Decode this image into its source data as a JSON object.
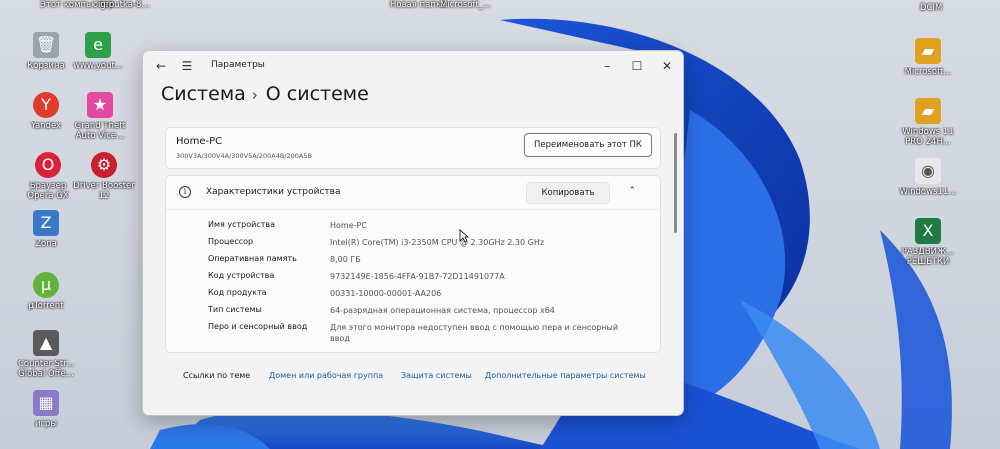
{
  "desktop": {
    "top_labels": {
      "this_pc": "Этот компьютер",
      "igroutka": "igroutka-8...",
      "new_folder": "Новая папка",
      "microsoft_top": "Microsoft_...",
      "dcim": "DCIM"
    },
    "left_icons": [
      {
        "label": "Корзина",
        "icon": "recycle-bin-icon",
        "color": "#9aa4b0"
      },
      {
        "label": "www.yout...",
        "icon": "web-shortcut-icon",
        "color": "#2fa04a"
      },
      {
        "label": "Yandex",
        "icon": "yandex-icon",
        "color": "#e03a2b"
      },
      {
        "label": "Grand Theft Auto Vice...",
        "icon": "gta-icon",
        "color": "#e44aa0"
      },
      {
        "label": "Браузер Opera GX",
        "icon": "opera-gx-icon",
        "color": "#d8243a"
      },
      {
        "label": "Driver Booster 12",
        "icon": "driver-booster-icon",
        "color": "#c81f2c"
      },
      {
        "label": "Zona",
        "icon": "zona-icon",
        "color": "#3a78c8"
      },
      {
        "label": "µTorrent",
        "icon": "utorrent-icon",
        "color": "#62b33c"
      },
      {
        "label": "Counter-Str... Global Offe...",
        "icon": "csgo-icon",
        "color": "#5a5a5a"
      },
      {
        "label": "игры",
        "icon": "games-folder-icon",
        "color": "#8a7ac8"
      }
    ],
    "right_icons": [
      {
        "label": "Microsoft...",
        "icon": "folder-icon",
        "color": "#e0a020"
      },
      {
        "label": "Windows 11 PRO 24H...",
        "icon": "folder-icon",
        "color": "#e0a020"
      },
      {
        "label": "Windows11...",
        "icon": "document-icon",
        "color": "#e8e8e8"
      },
      {
        "label": "РАЗДВИЖ... РЕШЕТКИ",
        "icon": "excel-icon",
        "color": "#1f7a45"
      }
    ]
  },
  "window": {
    "app_title": "Параметры",
    "breadcrumb_parent": "Система",
    "breadcrumb_separator": "›",
    "page_title": "О системе",
    "pc_name": "Home-PC",
    "pc_model": "300V3A/300V4A/300V5A/200A4B/200A5B",
    "rename_button": "Переименовать этот ПК",
    "specs_title": "Характеристики устройства",
    "copy_button": "Копировать",
    "specs": [
      {
        "label": "Имя устройства",
        "value": "Home-PC"
      },
      {
        "label": "Процессор",
        "value": "Intel(R) Core(TM) i3-2350M CPU @ 2.30GHz   2.30 GHz"
      },
      {
        "label": "Оперативная память",
        "value": "8,00 ГБ"
      },
      {
        "label": "Код устройства",
        "value": "9732149E-1856-4FFA-91B7-72D11491077A"
      },
      {
        "label": "Код продукта",
        "value": "00331-10000-00001-AA206"
      },
      {
        "label": "Тип системы",
        "value": "64-разрядная операционная система, процессор x64"
      },
      {
        "label": "Перо и сенсорный ввод",
        "value": "Для этого монитора недоступен ввод с помощью пера и сенсорный ввод"
      }
    ],
    "related_label": "Ссылки по теме",
    "related_links": [
      "Домен или рабочая группа",
      "Защита системы",
      "Дополнительные параметры системы"
    ]
  }
}
